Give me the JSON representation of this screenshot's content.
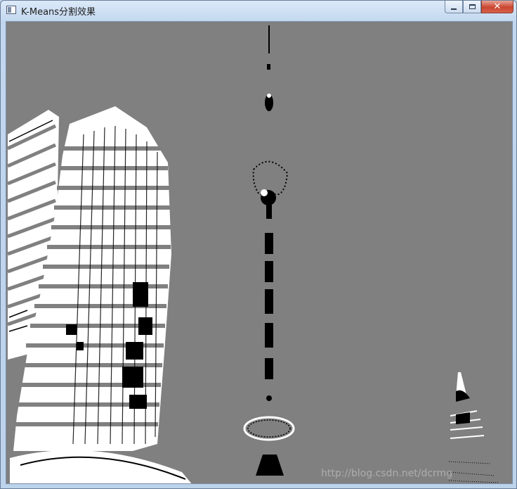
{
  "window": {
    "title": "K-Means分割效果",
    "icon": "window-app-icon",
    "controls": {
      "minimize": "minimize-icon",
      "maximize": "maximize-icon",
      "close": "close-icon"
    }
  },
  "image": {
    "background_color": "#808080",
    "cluster_colors": [
      "#808080",
      "#ffffff",
      "#000000"
    ],
    "watermark": "http://blog.csdn.net/dcrmg"
  }
}
